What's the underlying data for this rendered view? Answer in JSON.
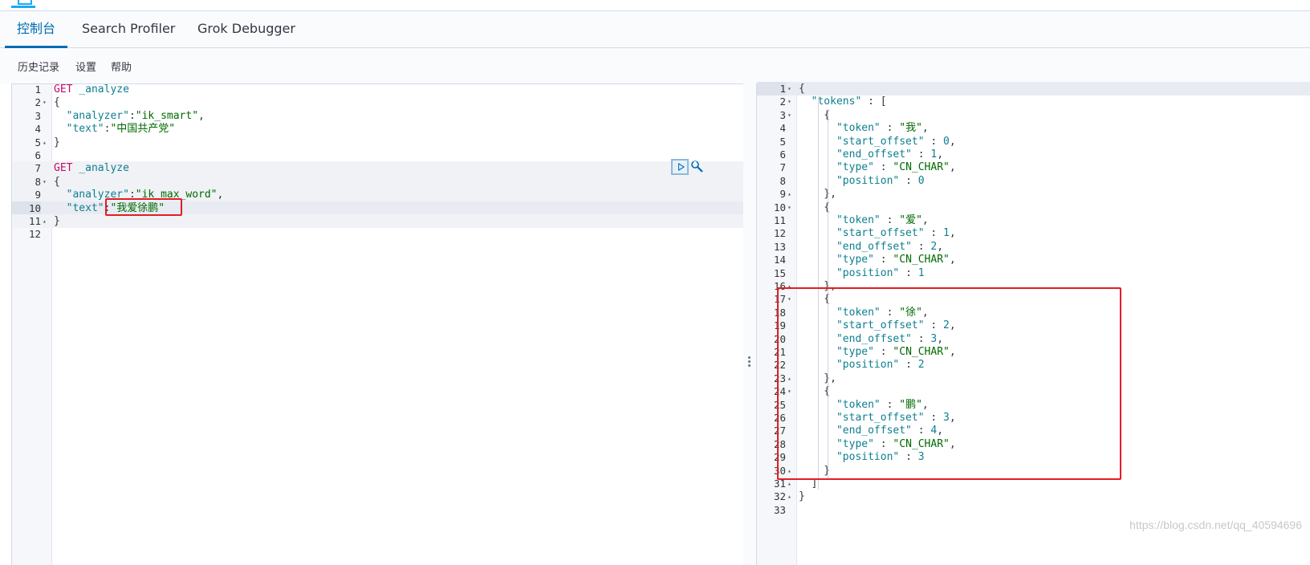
{
  "tabs": [
    {
      "label": "控制台",
      "active": true
    },
    {
      "label": "Search Profiler",
      "active": false
    },
    {
      "label": "Grok Debugger",
      "active": false
    }
  ],
  "toolbar": {
    "history": "历史记录",
    "settings": "设置",
    "help": "帮助"
  },
  "request_editor": {
    "lines": [
      {
        "n": "1",
        "fold": "",
        "tokens": [
          [
            "t-method",
            "GET"
          ],
          [
            "t-url",
            " _analyze"
          ]
        ]
      },
      {
        "n": "2",
        "fold": "▾",
        "tokens": [
          [
            "t-punc",
            "{"
          ]
        ]
      },
      {
        "n": "3",
        "fold": "",
        "tokens": [
          [
            "t-punc",
            "  "
          ],
          [
            "t-key",
            "\"analyzer\""
          ],
          [
            "t-punc",
            ":"
          ],
          [
            "t-str",
            "\"ik_smart\""
          ],
          [
            "t-punc",
            ","
          ]
        ]
      },
      {
        "n": "4",
        "fold": "",
        "tokens": [
          [
            "t-punc",
            "  "
          ],
          [
            "t-key",
            "\"text\""
          ],
          [
            "t-punc",
            ":"
          ],
          [
            "t-str",
            "\"中国共产党\""
          ]
        ]
      },
      {
        "n": "5",
        "fold": "▴",
        "tokens": [
          [
            "t-punc",
            "}"
          ]
        ]
      },
      {
        "n": "6",
        "fold": "",
        "tokens": []
      },
      {
        "n": "7",
        "fold": "",
        "tokens": [
          [
            "t-method",
            "GET"
          ],
          [
            "t-url",
            " _analyze"
          ]
        ]
      },
      {
        "n": "8",
        "fold": "▾",
        "tokens": [
          [
            "t-punc",
            "{"
          ]
        ]
      },
      {
        "n": "9",
        "fold": "",
        "tokens": [
          [
            "t-punc",
            "  "
          ],
          [
            "t-key",
            "\"analyzer\""
          ],
          [
            "t-punc",
            ":"
          ],
          [
            "t-str",
            "\"ik_max_word\""
          ],
          [
            "t-punc",
            ","
          ]
        ]
      },
      {
        "n": "10",
        "fold": "",
        "tokens": [
          [
            "t-punc",
            "  "
          ],
          [
            "t-key",
            "\"text\""
          ],
          [
            "t-punc",
            ":"
          ],
          [
            "t-str",
            "\"我爱徐鹏\""
          ]
        ]
      },
      {
        "n": "11",
        "fold": "▴",
        "tokens": [
          [
            "t-punc",
            "}"
          ]
        ]
      },
      {
        "n": "12",
        "fold": "",
        "tokens": []
      }
    ]
  },
  "response_editor": {
    "lines": [
      {
        "n": "1",
        "fold": "▾",
        "tokens": [
          [
            "t-punc",
            "{"
          ]
        ]
      },
      {
        "n": "2",
        "fold": "▾",
        "tokens": [
          [
            "t-punc",
            "  "
          ],
          [
            "t-key",
            "\"tokens\""
          ],
          [
            "t-punc",
            " : ["
          ]
        ]
      },
      {
        "n": "3",
        "fold": "▾",
        "tokens": [
          [
            "t-punc",
            "    {"
          ]
        ]
      },
      {
        "n": "4",
        "fold": "",
        "tokens": [
          [
            "t-punc",
            "      "
          ],
          [
            "t-key",
            "\"token\""
          ],
          [
            "t-punc",
            " : "
          ],
          [
            "t-str",
            "\"我\""
          ],
          [
            "t-punc",
            ","
          ]
        ]
      },
      {
        "n": "5",
        "fold": "",
        "tokens": [
          [
            "t-punc",
            "      "
          ],
          [
            "t-key",
            "\"start_offset\""
          ],
          [
            "t-punc",
            " : "
          ],
          [
            "t-num",
            "0"
          ],
          [
            "t-punc",
            ","
          ]
        ]
      },
      {
        "n": "6",
        "fold": "",
        "tokens": [
          [
            "t-punc",
            "      "
          ],
          [
            "t-key",
            "\"end_offset\""
          ],
          [
            "t-punc",
            " : "
          ],
          [
            "t-num",
            "1"
          ],
          [
            "t-punc",
            ","
          ]
        ]
      },
      {
        "n": "7",
        "fold": "",
        "tokens": [
          [
            "t-punc",
            "      "
          ],
          [
            "t-key",
            "\"type\""
          ],
          [
            "t-punc",
            " : "
          ],
          [
            "t-str",
            "\"CN_CHAR\""
          ],
          [
            "t-punc",
            ","
          ]
        ]
      },
      {
        "n": "8",
        "fold": "",
        "tokens": [
          [
            "t-punc",
            "      "
          ],
          [
            "t-key",
            "\"position\""
          ],
          [
            "t-punc",
            " : "
          ],
          [
            "t-num",
            "0"
          ]
        ]
      },
      {
        "n": "9",
        "fold": "▴",
        "tokens": [
          [
            "t-punc",
            "    },"
          ]
        ]
      },
      {
        "n": "10",
        "fold": "▾",
        "tokens": [
          [
            "t-punc",
            "    {"
          ]
        ]
      },
      {
        "n": "11",
        "fold": "",
        "tokens": [
          [
            "t-punc",
            "      "
          ],
          [
            "t-key",
            "\"token\""
          ],
          [
            "t-punc",
            " : "
          ],
          [
            "t-str",
            "\"爱\""
          ],
          [
            "t-punc",
            ","
          ]
        ]
      },
      {
        "n": "12",
        "fold": "",
        "tokens": [
          [
            "t-punc",
            "      "
          ],
          [
            "t-key",
            "\"start_offset\""
          ],
          [
            "t-punc",
            " : "
          ],
          [
            "t-num",
            "1"
          ],
          [
            "t-punc",
            ","
          ]
        ]
      },
      {
        "n": "13",
        "fold": "",
        "tokens": [
          [
            "t-punc",
            "      "
          ],
          [
            "t-key",
            "\"end_offset\""
          ],
          [
            "t-punc",
            " : "
          ],
          [
            "t-num",
            "2"
          ],
          [
            "t-punc",
            ","
          ]
        ]
      },
      {
        "n": "14",
        "fold": "",
        "tokens": [
          [
            "t-punc",
            "      "
          ],
          [
            "t-key",
            "\"type\""
          ],
          [
            "t-punc",
            " : "
          ],
          [
            "t-str",
            "\"CN_CHAR\""
          ],
          [
            "t-punc",
            ","
          ]
        ]
      },
      {
        "n": "15",
        "fold": "",
        "tokens": [
          [
            "t-punc",
            "      "
          ],
          [
            "t-key",
            "\"position\""
          ],
          [
            "t-punc",
            " : "
          ],
          [
            "t-num",
            "1"
          ]
        ]
      },
      {
        "n": "16",
        "fold": "▴",
        "tokens": [
          [
            "t-punc",
            "    },"
          ]
        ]
      },
      {
        "n": "17",
        "fold": "▾",
        "tokens": [
          [
            "t-punc",
            "    {"
          ]
        ]
      },
      {
        "n": "18",
        "fold": "",
        "tokens": [
          [
            "t-punc",
            "      "
          ],
          [
            "t-key",
            "\"token\""
          ],
          [
            "t-punc",
            " : "
          ],
          [
            "t-str",
            "\"徐\""
          ],
          [
            "t-punc",
            ","
          ]
        ]
      },
      {
        "n": "19",
        "fold": "",
        "tokens": [
          [
            "t-punc",
            "      "
          ],
          [
            "t-key",
            "\"start_offset\""
          ],
          [
            "t-punc",
            " : "
          ],
          [
            "t-num",
            "2"
          ],
          [
            "t-punc",
            ","
          ]
        ]
      },
      {
        "n": "20",
        "fold": "",
        "tokens": [
          [
            "t-punc",
            "      "
          ],
          [
            "t-key",
            "\"end_offset\""
          ],
          [
            "t-punc",
            " : "
          ],
          [
            "t-num",
            "3"
          ],
          [
            "t-punc",
            ","
          ]
        ]
      },
      {
        "n": "21",
        "fold": "",
        "tokens": [
          [
            "t-punc",
            "      "
          ],
          [
            "t-key",
            "\"type\""
          ],
          [
            "t-punc",
            " : "
          ],
          [
            "t-str",
            "\"CN_CHAR\""
          ],
          [
            "t-punc",
            ","
          ]
        ]
      },
      {
        "n": "22",
        "fold": "",
        "tokens": [
          [
            "t-punc",
            "      "
          ],
          [
            "t-key",
            "\"position\""
          ],
          [
            "t-punc",
            " : "
          ],
          [
            "t-num",
            "2"
          ]
        ]
      },
      {
        "n": "23",
        "fold": "▴",
        "tokens": [
          [
            "t-punc",
            "    },"
          ]
        ]
      },
      {
        "n": "24",
        "fold": "▾",
        "tokens": [
          [
            "t-punc",
            "    {"
          ]
        ]
      },
      {
        "n": "25",
        "fold": "",
        "tokens": [
          [
            "t-punc",
            "      "
          ],
          [
            "t-key",
            "\"token\""
          ],
          [
            "t-punc",
            " : "
          ],
          [
            "t-str",
            "\"鹏\""
          ],
          [
            "t-punc",
            ","
          ]
        ]
      },
      {
        "n": "26",
        "fold": "",
        "tokens": [
          [
            "t-punc",
            "      "
          ],
          [
            "t-key",
            "\"start_offset\""
          ],
          [
            "t-punc",
            " : "
          ],
          [
            "t-num",
            "3"
          ],
          [
            "t-punc",
            ","
          ]
        ]
      },
      {
        "n": "27",
        "fold": "",
        "tokens": [
          [
            "t-punc",
            "      "
          ],
          [
            "t-key",
            "\"end_offset\""
          ],
          [
            "t-punc",
            " : "
          ],
          [
            "t-num",
            "4"
          ],
          [
            "t-punc",
            ","
          ]
        ]
      },
      {
        "n": "28",
        "fold": "",
        "tokens": [
          [
            "t-punc",
            "      "
          ],
          [
            "t-key",
            "\"type\""
          ],
          [
            "t-punc",
            " : "
          ],
          [
            "t-str",
            "\"CN_CHAR\""
          ],
          [
            "t-punc",
            ","
          ]
        ]
      },
      {
        "n": "29",
        "fold": "",
        "tokens": [
          [
            "t-punc",
            "      "
          ],
          [
            "t-key",
            "\"position\""
          ],
          [
            "t-punc",
            " : "
          ],
          [
            "t-num",
            "3"
          ]
        ]
      },
      {
        "n": "30",
        "fold": "▴",
        "tokens": [
          [
            "t-punc",
            "    }"
          ]
        ]
      },
      {
        "n": "31",
        "fold": "▴",
        "tokens": [
          [
            "t-punc",
            "  ]"
          ]
        ]
      },
      {
        "n": "32",
        "fold": "▴",
        "tokens": [
          [
            "t-punc",
            "}"
          ]
        ]
      },
      {
        "n": "33",
        "fold": "",
        "tokens": []
      }
    ]
  },
  "watermark": "https://blog.csdn.net/qq_40594696",
  "colors": {
    "accent": "#006bb4",
    "highlight_box": "#e51c23"
  }
}
